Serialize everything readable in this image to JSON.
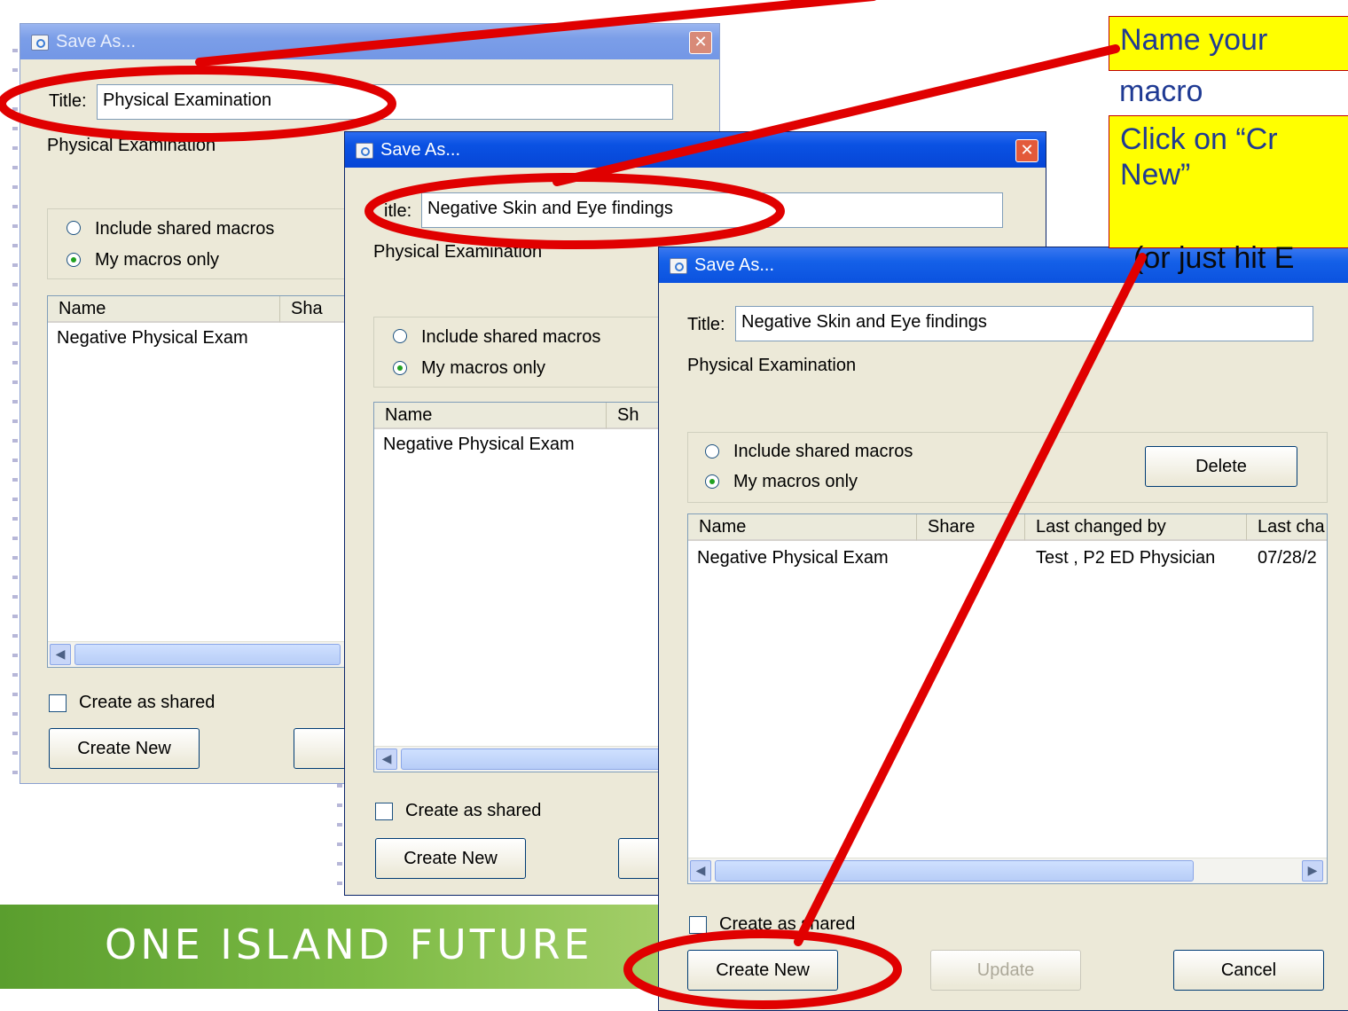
{
  "banner": {
    "text": "ONE ISLAND FUTURE"
  },
  "callouts": {
    "name_macro_line1": "Name your",
    "name_macro_line2": "macro",
    "click_create_line1": "Click on “Cr",
    "click_create_line2": "New”",
    "click_create_line3": "(or just hit E"
  },
  "dialog1": {
    "title": "Save As...",
    "title_label": "Title:",
    "title_value": "Physical Examination",
    "folder": "Physical Examination",
    "radio_shared": "Include shared macros",
    "radio_mine": "My macros only",
    "col_name": "Name",
    "col_shared": "Sha",
    "rows": [
      "Negative Physical Exam"
    ],
    "checkbox_label": "Create as shared",
    "create_button": "Create New"
  },
  "dialog2": {
    "title": "Save As...",
    "title_label": "itle:",
    "title_value": "Negative Skin and Eye findings",
    "folder": "Physical Examination",
    "radio_shared": "Include shared macros",
    "radio_mine": "My macros only",
    "col_name": "Name",
    "col_shared": "Sh",
    "rows": [
      "Negative Physical Exam"
    ],
    "checkbox_label": "Create as shared",
    "create_button": "Create New"
  },
  "dialog3": {
    "title": "Save As...",
    "title_label": "Title:",
    "title_value": "Negative Skin and Eye findings",
    "folder": "Physical Examination",
    "radio_shared": "Include shared macros",
    "radio_mine": "My macros only",
    "delete_button": "Delete",
    "columns": [
      "Name",
      "Share",
      "Last changed by",
      "Last cha"
    ],
    "rows": [
      {
        "name": "Negative Physical Exam",
        "shared": "",
        "changed_by": "Test , P2 ED Physician",
        "changed": "07/28/2"
      }
    ],
    "checkbox_label": "Create as shared",
    "create_button": "Create New",
    "update_button": "Update",
    "cancel_button": "Cancel"
  },
  "colors": {
    "annotation_red": "#e00000",
    "callout_yellow": "#ffff00",
    "xp_blue": "#0a52e3"
  }
}
